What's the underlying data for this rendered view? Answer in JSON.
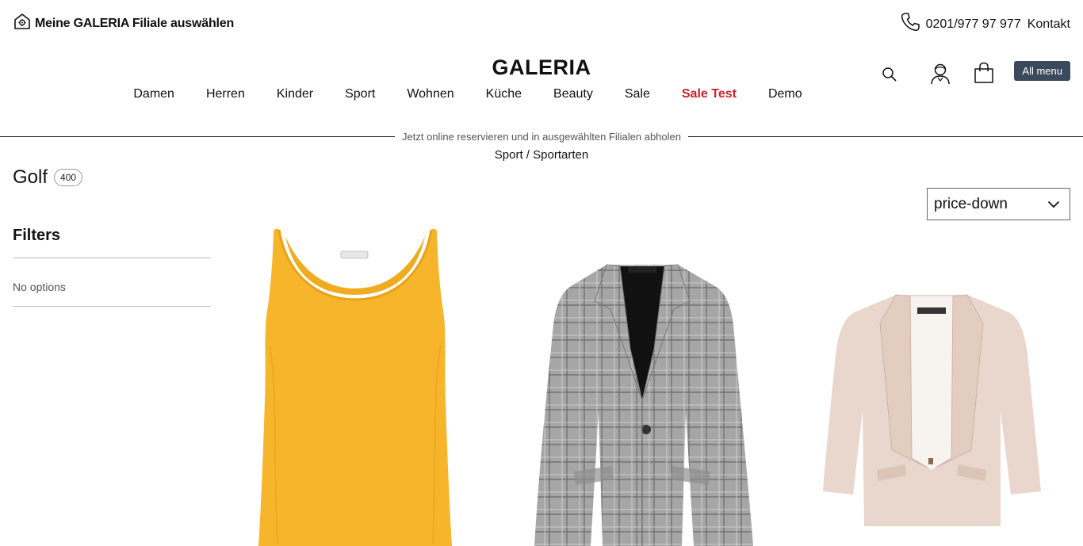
{
  "topbar": {
    "store_label": "Meine GALERIA Filiale auswählen",
    "phone": "0201/977 97 977",
    "contact_label": "Kontakt"
  },
  "header": {
    "logo": "GALERIA",
    "menu_button": "All menu"
  },
  "nav": {
    "items": [
      {
        "label": "Damen"
      },
      {
        "label": "Herren"
      },
      {
        "label": "Kinder"
      },
      {
        "label": "Sport"
      },
      {
        "label": "Wohnen"
      },
      {
        "label": "Küche"
      },
      {
        "label": "Beauty"
      },
      {
        "label": "Sale"
      },
      {
        "label": "Sale Test"
      },
      {
        "label": "Demo"
      }
    ]
  },
  "promo": {
    "text": "Jetzt online reservieren und in ausgewählten Filialen abholen"
  },
  "breadcrumb": {
    "first": "Sport",
    "separator": " / ",
    "second": "Sportarten"
  },
  "page": {
    "title": "Golf",
    "count": "400"
  },
  "sort": {
    "selected": "price-down"
  },
  "filters": {
    "heading": "Filters",
    "empty_text": "No options"
  },
  "colors": {
    "accent_red": "#d0202a",
    "menu_button_bg": "#3a4a5c",
    "product_yellow": "#f6b52a",
    "product_grey": "#9a9a9a",
    "product_beige": "#e9d6cc"
  }
}
